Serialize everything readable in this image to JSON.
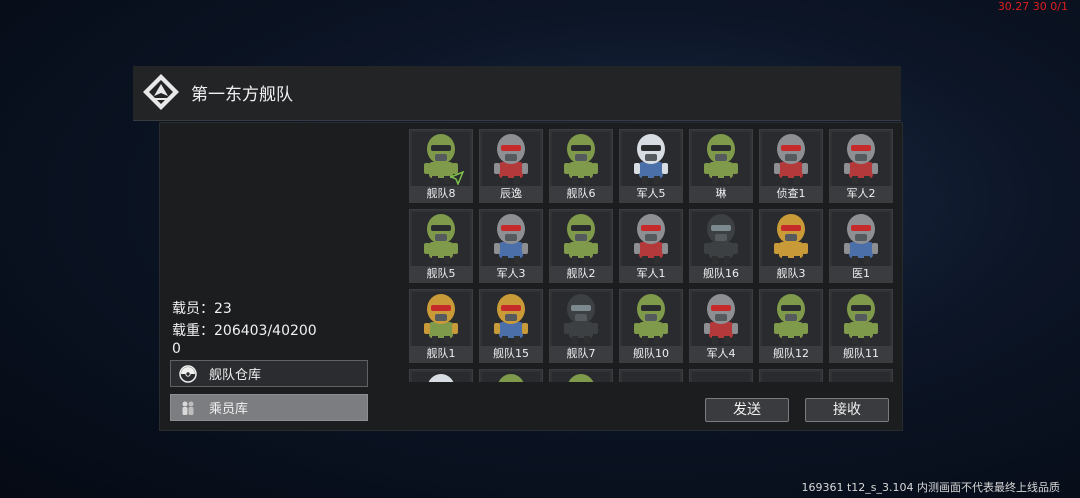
{
  "debug": {
    "top_right": "30.27 30 0/1"
  },
  "build": {
    "info": "169361 t12_s_3.104 内测画面不代表最终上线品质"
  },
  "fleet": {
    "name": "第一东方舰队"
  },
  "stats": {
    "crew_label": "载员：",
    "crew_value": "23",
    "load_label": "载重：",
    "load_value": "206403/402000"
  },
  "sidebar": {
    "warehouse_label": "舰队仓库",
    "crew_label": "乘员库"
  },
  "actions": {
    "send": "发送",
    "receive": "接收"
  },
  "colors": {
    "green_helmet": "#7f9a4a",
    "gray_helmet": "#8d8f93",
    "white_helmet": "#d7dde2",
    "gold_helmet": "#c99a38",
    "dark_helmet": "#3d4042",
    "red_visor": "#c62a2a"
  },
  "roster": [
    {
      "name": "舰队8",
      "helmet": "green",
      "body": "green",
      "flag": true
    },
    {
      "name": "辰逸",
      "helmet": "gray",
      "body": "red"
    },
    {
      "name": "舰队6",
      "helmet": "green",
      "body": "green"
    },
    {
      "name": "军人5",
      "helmet": "white",
      "body": "blue"
    },
    {
      "name": "琳",
      "helmet": "green",
      "body": "green"
    },
    {
      "name": "侦查1",
      "helmet": "gray",
      "body": "red"
    },
    {
      "name": "军人2",
      "helmet": "gray",
      "body": "red"
    },
    {
      "name": "舰队5",
      "helmet": "green",
      "body": "green"
    },
    {
      "name": "军人3",
      "helmet": "gray",
      "body": "blue"
    },
    {
      "name": "舰队2",
      "helmet": "green",
      "body": "green"
    },
    {
      "name": "军人1",
      "helmet": "gray",
      "body": "red"
    },
    {
      "name": "舰队16",
      "helmet": "dark",
      "body": "dark"
    },
    {
      "name": "舰队3",
      "helmet": "gold",
      "body": "gold"
    },
    {
      "name": "医1",
      "helmet": "gray",
      "body": "blue"
    },
    {
      "name": "舰队1",
      "helmet": "gold",
      "body": "green"
    },
    {
      "name": "舰队15",
      "helmet": "gold",
      "body": "blue"
    },
    {
      "name": "舰队7",
      "helmet": "dark",
      "body": "dark"
    },
    {
      "name": "舰队10",
      "helmet": "green",
      "body": "green"
    },
    {
      "name": "军人4",
      "helmet": "gray",
      "body": "red"
    },
    {
      "name": "舰队12",
      "helmet": "green",
      "body": "green"
    },
    {
      "name": "舰队11",
      "helmet": "green",
      "body": "green"
    },
    {
      "name": "",
      "helmet": "white",
      "body": "blue"
    },
    {
      "name": "",
      "helmet": "green",
      "body": "green"
    },
    {
      "name": "",
      "helmet": "green",
      "body": "green"
    },
    {
      "name": "",
      "helmet": "",
      "body": ""
    },
    {
      "name": "",
      "helmet": "",
      "body": ""
    },
    {
      "name": "",
      "helmet": "",
      "body": ""
    },
    {
      "name": "",
      "helmet": "",
      "body": ""
    }
  ]
}
